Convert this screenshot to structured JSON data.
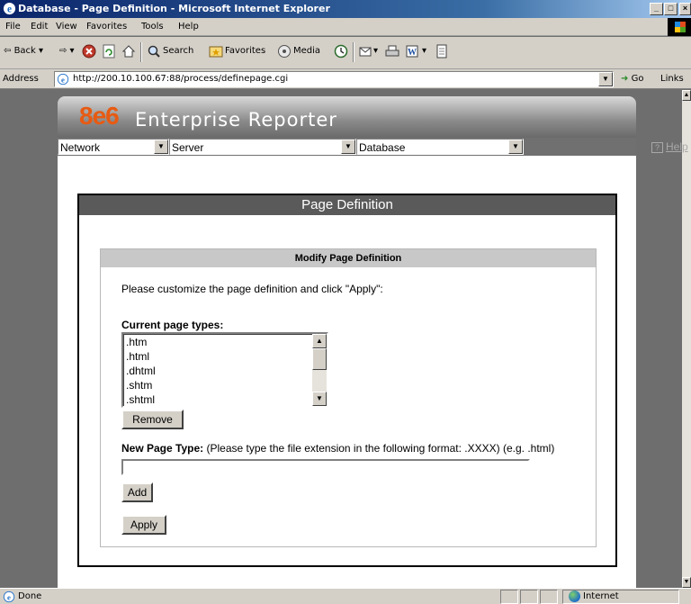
{
  "window": {
    "title": "Database - Page Definition - Microsoft Internet Explorer",
    "minimize": "_",
    "maximize": "□",
    "close": "×"
  },
  "menu": [
    "File",
    "Edit",
    "View",
    "Favorites",
    "Tools",
    "Help"
  ],
  "toolbar": {
    "back": "Back",
    "search": "Search",
    "favorites": "Favorites",
    "media": "Media"
  },
  "address": {
    "label": "Address",
    "url": "http://200.10.100.67:88/process/definepage.cgi",
    "go": "Go",
    "links": "Links"
  },
  "header": {
    "logo_mark": "8e6",
    "product_name": "Enterprise Reporter"
  },
  "nav": {
    "network": "Network",
    "server": "Server",
    "database": "Database",
    "help": "Help"
  },
  "panel": {
    "title": "Page Definition",
    "section_title": "Modify Page Definition",
    "instructions": "Please customize the page definition and click \"Apply\":",
    "current_types_label": "Current page types:",
    "page_types": [
      ".htm",
      ".html",
      ".dhtml",
      ".shtm",
      ".shtml"
    ],
    "remove_button": "Remove",
    "new_type_label": "New Page Type:",
    "new_type_hint": "(Please type the file extension in the following format: .XXXX) (e.g. .html)",
    "new_type_value": "",
    "add_button": "Add",
    "apply_button": "Apply"
  },
  "status": {
    "text": "Done",
    "zone": "Internet"
  }
}
